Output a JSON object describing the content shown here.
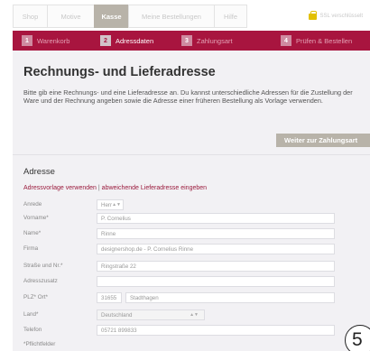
{
  "topnav": {
    "tabs": [
      {
        "label": "Shop"
      },
      {
        "label": "Motive"
      },
      {
        "label": "Kasse"
      },
      {
        "label": "Meine Bestellungen"
      },
      {
        "label": "Hilfe"
      }
    ],
    "active_tab": "Kasse",
    "cart_label": "SSL verschlüsselt"
  },
  "steps": [
    {
      "number": "1",
      "label": "Warenkorb"
    },
    {
      "number": "2",
      "label": "Adressdaten"
    },
    {
      "number": "3",
      "label": "Zahlungsart"
    },
    {
      "number": "4",
      "label": "Prüfen & Bestellen"
    }
  ],
  "active_step": "Adressdaten",
  "page": {
    "title": "Rechnungs- und Lieferadresse",
    "intro": "Bitte gib eine Rechnungs- und eine Lieferadresse an. Du kannst unterschiedliche Adressen für die Zustellung der Ware und der Rechnung angeben sowie die Adresse einer früheren Bestellung als Vorlage verwenden.",
    "next_button": "Weiter zur Zahlungsart"
  },
  "address": {
    "section_title": "Adresse",
    "link_template": "Adressvorlage verwenden",
    "link_separator": "|",
    "link_alternate": "abweichende Lieferadresse eingeben",
    "fields": {
      "anrede": {
        "label": "Anrede",
        "value": "Herr"
      },
      "vorname": {
        "label": "Vorname*",
        "value": "P. Cornelius"
      },
      "name": {
        "label": "Name*",
        "value": "Rinne"
      },
      "firma": {
        "label": "Firma",
        "value": "designershop.de - P. Cornelius Rinne"
      },
      "strasse": {
        "label": "Straße und Nr.*",
        "value": "Ringstraße 22"
      },
      "zusatz": {
        "label": "Adresszusatz",
        "value": ""
      },
      "plz_ort": {
        "label": "PLZ* Ort*",
        "plz": "31655",
        "ort": "Stadthagen"
      },
      "land": {
        "label": "Land*",
        "value": "Deutschland"
      },
      "telefon": {
        "label": "Telefon",
        "value": "05721 899833"
      }
    },
    "footnote": "*Pflichtfelder"
  },
  "badge": {
    "label": "5"
  },
  "colors": {
    "brand": "#a8153f",
    "accent_gray": "#b8b3a9",
    "content_bg": "#f2f1f4",
    "link": "#9a1a3c"
  }
}
